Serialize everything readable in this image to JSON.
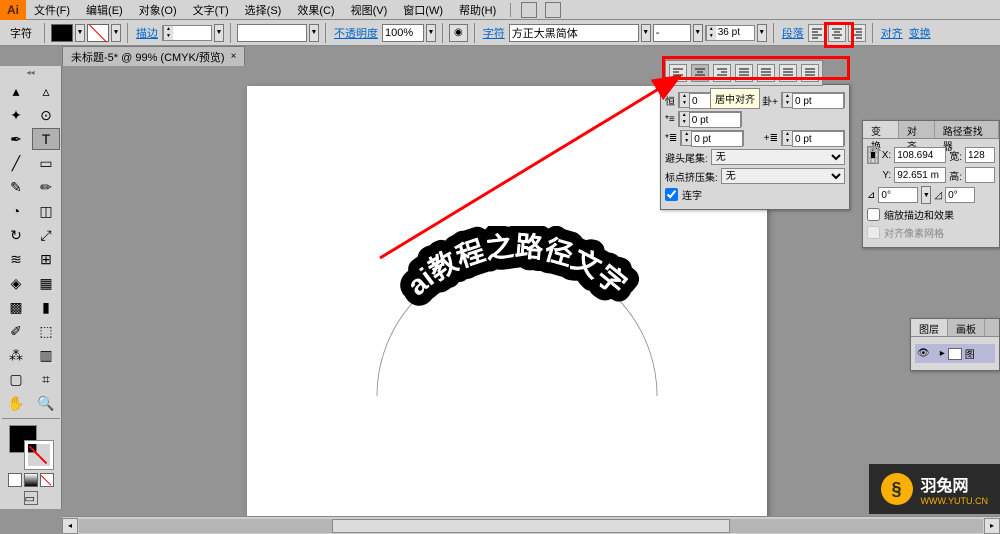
{
  "app_icon": "Ai",
  "menus": [
    "文件(F)",
    "编辑(E)",
    "对象(O)",
    "文字(T)",
    "选择(S)",
    "效果(C)",
    "视图(V)",
    "窗口(W)",
    "帮助(H)"
  ],
  "controlbar": {
    "char_label": "字符",
    "stroke_label": "描边",
    "stroke_pt": "",
    "opacity_label": "不透明度",
    "opacity_value": "100%",
    "char_link": "字符",
    "font_name": "方正大黑简体",
    "font_style": "-",
    "font_size": "36 pt",
    "para_link": "段落",
    "align_link": "对齐",
    "transform_link": "变换"
  },
  "tab": {
    "title": "未标题-5* @ 99% (CMYK/预览)",
    "close": "×"
  },
  "canvas_text": "ai教程之路径文字",
  "tooltip": "居中对齐",
  "paragraph_panel": {
    "left_indent": "0",
    "right_indent": "0 pt",
    "first_line": "0 pt",
    "space_before": "0 pt",
    "space_after": "0 pt",
    "hyphen_label": "避头尾集:",
    "hyphen_value": "无",
    "punct_label": "标点挤压集:",
    "punct_value": "无",
    "ligature": "连字"
  },
  "transform_panel": {
    "tabs": [
      "变换",
      "对齐",
      "路径查找器"
    ],
    "x_label": "X:",
    "x_value": "108.694",
    "w_label": "宽:",
    "w_value": "128",
    "y_label": "Y:",
    "y_value": "92.651 m",
    "h_label": "高:",
    "h_value": "",
    "angle1": "0°",
    "angle2": "0°",
    "scale_label": "缩放描边和效果",
    "align_grid": "对齐像素网格"
  },
  "layers_panel": {
    "tabs": [
      "图层",
      "画板"
    ],
    "layer_name": "图"
  },
  "watermark": {
    "logo": "§",
    "title": "羽兔网",
    "url": "WWW.YUTU.CN"
  }
}
